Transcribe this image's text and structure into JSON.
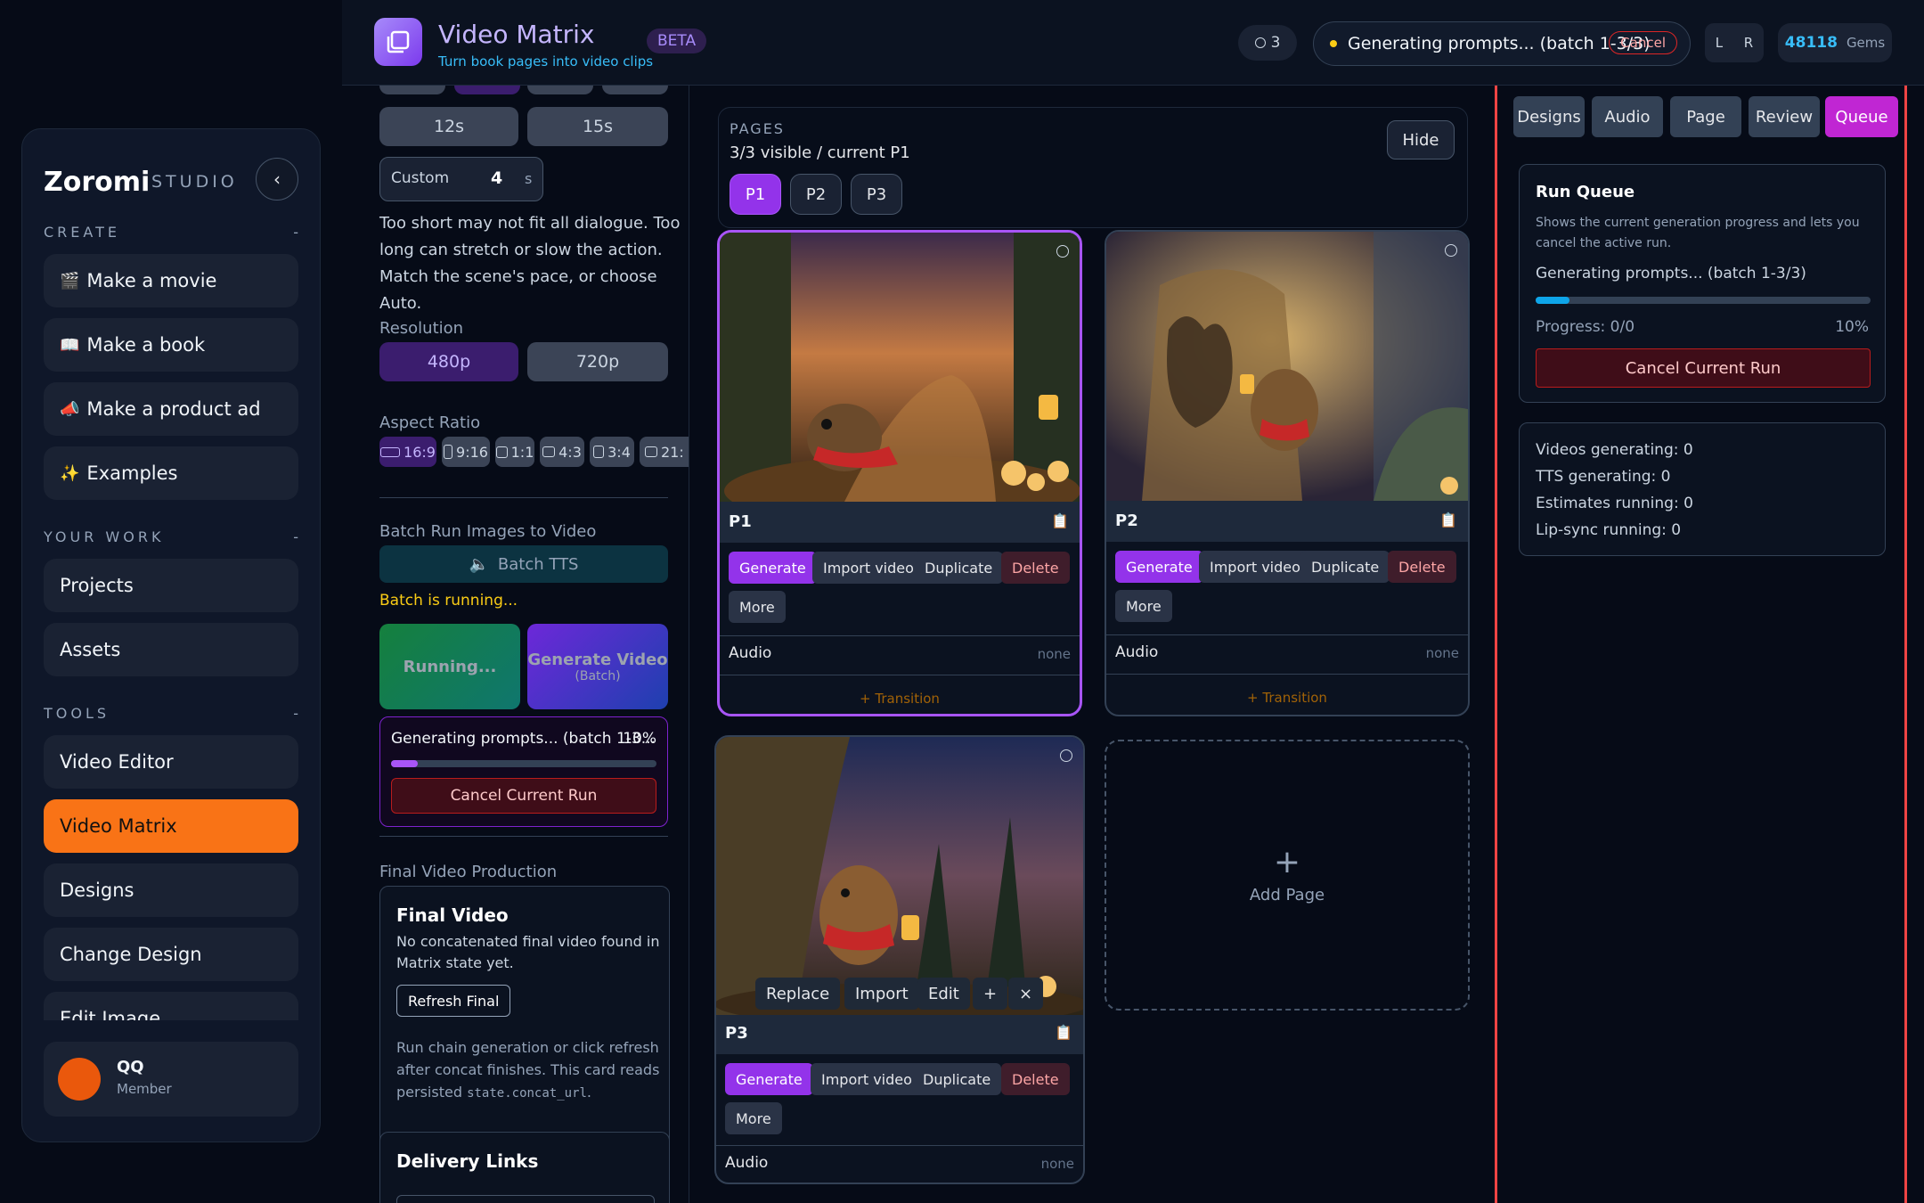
{
  "header": {
    "title": "Video Matrix",
    "subtitle": "Turn book pages into video clips",
    "beta": "BETA",
    "queue_count": "3",
    "status_text": "Generating prompts... (batch 1-3/3)",
    "status_cancel": "Cancel",
    "left_toggle": "L",
    "right_toggle": "R",
    "gems_value": "48118",
    "gems_label": "Gems"
  },
  "sidebar": {
    "brand": "Zoromi",
    "brand_sub": "STUDIO",
    "create_label": "CREATE",
    "yourwork_label": "YOUR WORK",
    "tools_label": "TOOLS",
    "collapse_dash": "-",
    "create_items": [
      {
        "icon": "🎬",
        "label": "Make a movie"
      },
      {
        "icon": "📖",
        "label": "Make a book"
      },
      {
        "icon": "📣",
        "label": "Make a product ad"
      },
      {
        "icon": "✨",
        "label": "Examples"
      }
    ],
    "work_items": [
      "Projects",
      "Assets"
    ],
    "tool_items": [
      "Video Editor",
      "Video Matrix",
      "Designs",
      "Change Design",
      "Edit Image"
    ],
    "user": {
      "name": "QQ",
      "role": "Member"
    }
  },
  "settings": {
    "durations": [
      "12s",
      "15s"
    ],
    "custom_label": "Custom",
    "custom_value": "4",
    "custom_unit": "s",
    "duration_hint": "Too short may not fit all dialogue. Too long can stretch or slow the action. Match the scene's pace, or choose Auto.",
    "resolution_label": "Resolution",
    "resolutions": [
      "480p",
      "720p"
    ],
    "aspect_label": "Aspect Ratio",
    "aspects": [
      "16:9",
      "9:16",
      "1:1",
      "4:3",
      "3:4",
      "21:"
    ],
    "batch_label": "Batch Run Images to Video",
    "batch_tts": "Batch TTS",
    "batch_running": "Batch is running...",
    "running_btn": "Running...",
    "gen_video": "Generate Video",
    "gen_video_sub": "(Batch)",
    "progress_text": "Generating prompts... (batch 1-3...",
    "progress_pct": "10%",
    "progress_value": 0.1,
    "cancel_run": "Cancel Current Run",
    "final_label": "Final Video Production",
    "final_title": "Final Video",
    "final_desc": "No concatenated final video found in Matrix state yet.",
    "refresh": "Refresh Final",
    "final_note": "Run chain generation or click refresh after concat finishes. This card reads persisted",
    "final_code": "state.concat_url",
    "final_period": ".",
    "delivery_title": "Delivery Links"
  },
  "pages": {
    "label": "PAGES",
    "status": "3/3 visible / current P1",
    "hide": "Hide",
    "chips": [
      "P1",
      "P2",
      "P3"
    ],
    "add_page": "Add Page",
    "add_plus": "+"
  },
  "cards": [
    {
      "title": "P1",
      "buttons": [
        "Generate",
        "Import video",
        "Duplicate",
        "Delete",
        "More"
      ],
      "audio": "Audio",
      "audio_value": "none",
      "transition": "+ Transition"
    },
    {
      "title": "P2",
      "buttons": [
        "Generate",
        "Import video",
        "Duplicate",
        "Delete",
        "More"
      ],
      "audio": "Audio",
      "audio_value": "none",
      "transition": "+ Transition"
    },
    {
      "title": "P3",
      "buttons": [
        "Generate",
        "Import video",
        "Duplicate",
        "Delete",
        "More"
      ],
      "audio": "Audio",
      "audio_value": "none",
      "overlay": [
        "Replace",
        "Import",
        "Edit",
        "+",
        "×"
      ]
    }
  ],
  "right": {
    "tabs": [
      "Designs",
      "Audio",
      "Page",
      "Review",
      "Queue"
    ],
    "queue_title": "Run Queue",
    "queue_desc": "Shows the current generation progress and lets you cancel the active run.",
    "queue_status": "Generating prompts... (batch 1-3/3)",
    "progress_label": "Progress: 0/0",
    "progress_pct": "10%",
    "progress_value": 0.1,
    "cancel": "Cancel Current Run",
    "stats": [
      "Videos generating: 0",
      "TTS generating: 0",
      "Estimates running: 0",
      "Lip-sync running: 0"
    ]
  },
  "colors": {
    "accent": "#9333ea",
    "active_nav": "#f97316",
    "danger": "#ef4444",
    "progress_blue": "#0ea5e9"
  }
}
